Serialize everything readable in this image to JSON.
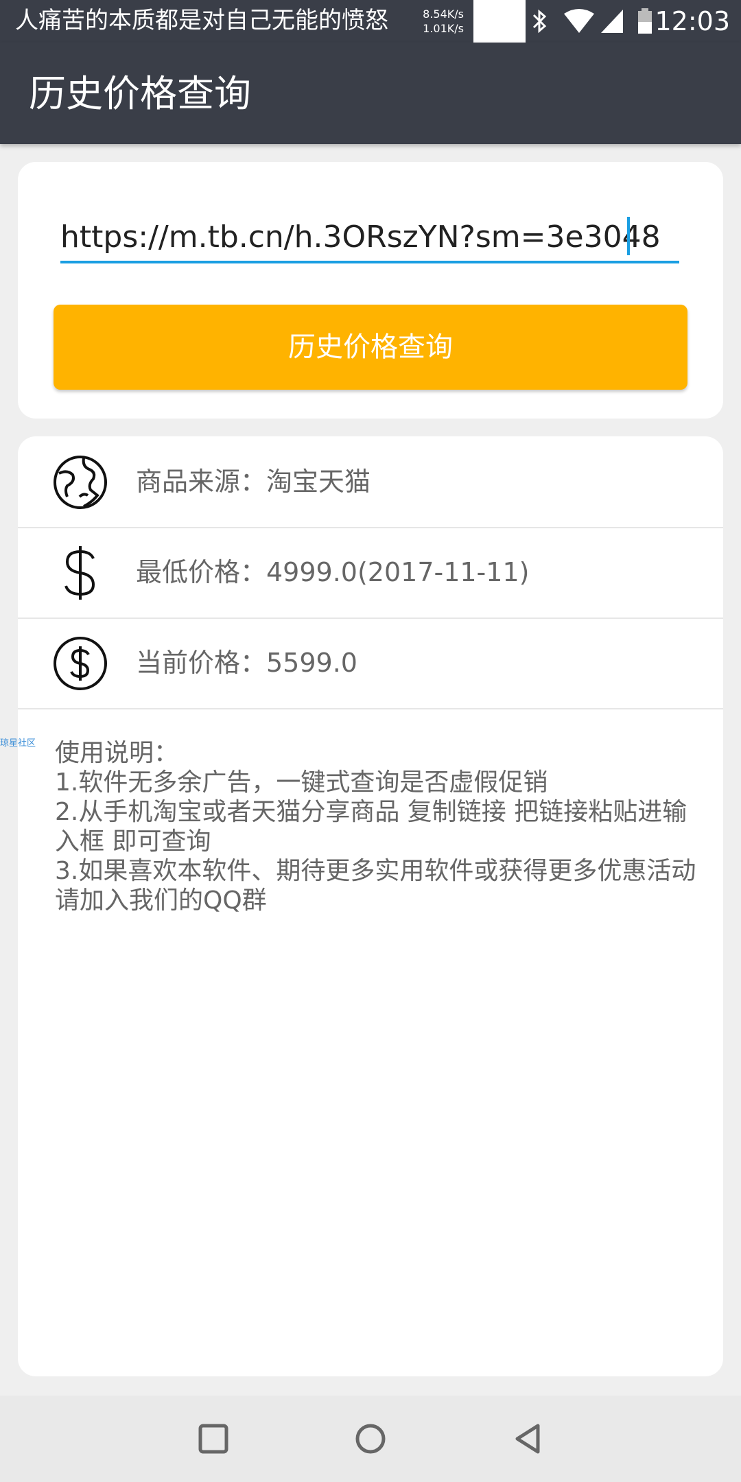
{
  "status_bar": {
    "notice": "人痛苦的本质都是对自己无能的愤怒",
    "net_up": "8.54K/s",
    "net_down": "1.01K/s",
    "time": "12:03",
    "icons": [
      "bluetooth-icon",
      "wifi-icon",
      "signal-icon",
      "battery-icon"
    ]
  },
  "app_bar": {
    "title": "历史价格查询"
  },
  "query": {
    "url_value": "https://m.tb.cn/h.3ORszYN?sm=3e3048",
    "button_label": "历史价格查询"
  },
  "results": {
    "source_label": "商品来源：淘宝天猫",
    "lowest_label": "最低价格：4999.0(2017-11-11)",
    "current_label": "当前价格：5599.0"
  },
  "instructions": {
    "title": "使用说明：",
    "line1": " 1.软件无多余广告，一键式查询是否虚假促销",
    "line2": " 2.从手机淘宝或者天猫分享商品 复制链接 把链接粘贴进输入框 即可查询",
    "line3": " 3.如果喜欢本软件、期待更多实用软件或获得更多优惠活动 请加入我们的QQ群"
  },
  "side_watermark": "琼星社区",
  "colors": {
    "app_bar": "#3a3e48",
    "accent": "#1a9ee2",
    "button": "#ffb300",
    "background": "#efefef"
  }
}
